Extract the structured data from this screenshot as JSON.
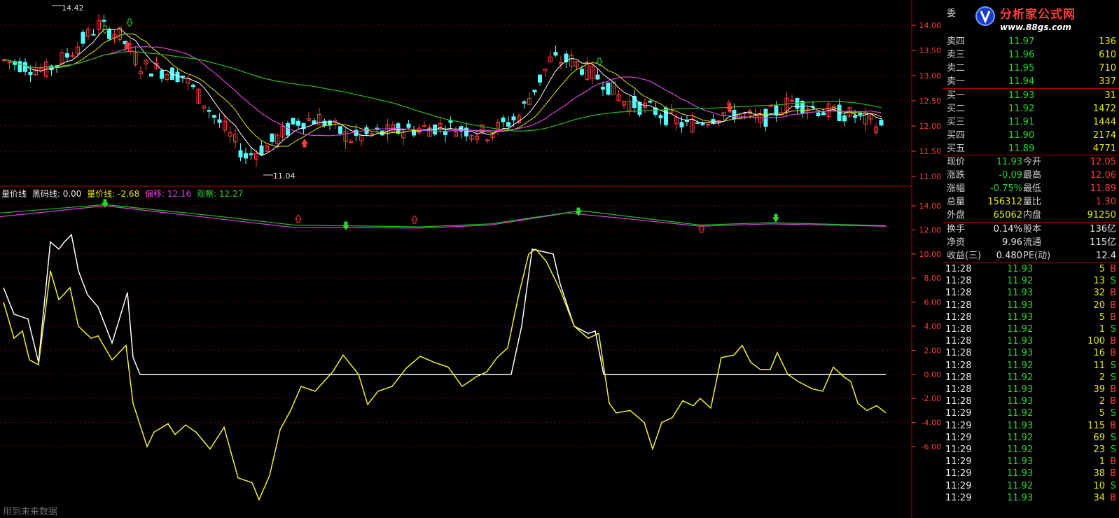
{
  "price_axis": [
    "14.00",
    "13.50",
    "13.00",
    "12.50",
    "12.00",
    "11.50",
    "11.00"
  ],
  "indicator_axis": [
    "14.00",
    "12.00",
    "10.00",
    "8.00",
    "6.00",
    "4.00",
    "2.00",
    "0.00",
    "-2.00",
    "-4.00",
    "-6.00"
  ],
  "price_labels": {
    "high": "14.42",
    "low": "11.04"
  },
  "indicator_header": {
    "name": "量价线",
    "black_code": "黑码线: 0.00",
    "vol_price": "量价线: -2.68",
    "offset": "偏移: 12.16",
    "observe": "观察: 12.27"
  },
  "colors": {
    "up": "#ff3c3c",
    "down": "#54fcfc",
    "ma5": "#ffffff",
    "ma10": "#e6e600",
    "ma20": "#e040e0",
    "ma60": "#20c020",
    "grid": "#7a0000",
    "white_line": "#ffffff",
    "yellow_line": "#f0f030"
  },
  "order_book": {
    "commission_label": "委",
    "sell": [
      {
        "label": "卖四",
        "price": "11.97",
        "vol": "136"
      },
      {
        "label": "卖三",
        "price": "11.96",
        "vol": "610"
      },
      {
        "label": "卖二",
        "price": "11.95",
        "vol": "710"
      },
      {
        "label": "卖一",
        "price": "11.94",
        "vol": "337"
      }
    ],
    "buy": [
      {
        "label": "买一",
        "price": "11.93",
        "vol": "31"
      },
      {
        "label": "买二",
        "price": "11.92",
        "vol": "1472"
      },
      {
        "label": "买三",
        "price": "11.91",
        "vol": "1444"
      },
      {
        "label": "买四",
        "price": "11.90",
        "vol": "2174"
      },
      {
        "label": "买五",
        "price": "11.89",
        "vol": "4771"
      }
    ]
  },
  "quote": [
    {
      "l1": "现价",
      "v1": "11.93",
      "l2": "今开",
      "v2": "12.05"
    },
    {
      "l1": "涨跌",
      "v1": "-0.09",
      "l2": "最高",
      "v2": "12.06"
    },
    {
      "l1": "涨幅",
      "v1": "-0.75%",
      "l2": "最低",
      "v2": "11.89"
    },
    {
      "l1": "总量",
      "v1": "156312",
      "l2": "量比",
      "v2": "1.30"
    },
    {
      "l1": "外盘",
      "v1": "65062",
      "l2": "内盘",
      "v2": "91250"
    }
  ],
  "stats": [
    {
      "l1": "换手",
      "v1": "0.14%",
      "l2": "股本",
      "v2": "136亿"
    },
    {
      "l1": "净资",
      "v1": "9.96",
      "l2": "流通",
      "v2": "115亿"
    },
    {
      "l1": "收益(三)",
      "v1": "0.480",
      "l2": "PE(动)",
      "v2": "12.4"
    }
  ],
  "ticks": [
    {
      "t": "11:28",
      "p": "11.93",
      "v": "5",
      "d": "B"
    },
    {
      "t": "11:28",
      "p": "11.92",
      "v": "13",
      "d": "S"
    },
    {
      "t": "11:28",
      "p": "11.93",
      "v": "32",
      "d": "B"
    },
    {
      "t": "11:28",
      "p": "11.93",
      "v": "20",
      "d": "B"
    },
    {
      "t": "11:28",
      "p": "11.93",
      "v": "5",
      "d": "B"
    },
    {
      "t": "11:28",
      "p": "11.92",
      "v": "1",
      "d": "S"
    },
    {
      "t": "11:28",
      "p": "11.93",
      "v": "100",
      "d": "B"
    },
    {
      "t": "11:28",
      "p": "11.93",
      "v": "16",
      "d": "B"
    },
    {
      "t": "11:28",
      "p": "11.92",
      "v": "11",
      "d": "S"
    },
    {
      "t": "11:28",
      "p": "11.92",
      "v": "2",
      "d": "S"
    },
    {
      "t": "11:28",
      "p": "11.93",
      "v": "39",
      "d": "B"
    },
    {
      "t": "11:28",
      "p": "11.93",
      "v": "2",
      "d": "B"
    },
    {
      "t": "11:29",
      "p": "11.92",
      "v": "5",
      "d": "S"
    },
    {
      "t": "11:29",
      "p": "11.93",
      "v": "115",
      "d": "B"
    },
    {
      "t": "11:29",
      "p": "11.92",
      "v": "69",
      "d": "S"
    },
    {
      "t": "11:29",
      "p": "11.92",
      "v": "23",
      "d": "S"
    },
    {
      "t": "11:29",
      "p": "11.93",
      "v": "1",
      "d": "B"
    },
    {
      "t": "11:29",
      "p": "11.93",
      "v": "38",
      "d": "B"
    },
    {
      "t": "11:29",
      "p": "11.92",
      "v": "10",
      "d": "S"
    },
    {
      "t": "11:29",
      "p": "11.93",
      "v": "34",
      "d": "B"
    }
  ],
  "logo": {
    "title": "分析家公式网",
    "url": "www.88gs.com"
  },
  "status_text": "用到未来数据"
}
